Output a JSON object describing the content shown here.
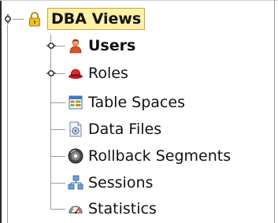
{
  "tree": {
    "root": {
      "label": "DBA Views",
      "icon": "lock-icon",
      "expanded": true,
      "selected": true
    },
    "children": [
      {
        "label": "Users",
        "icon": "user-icon",
        "bold": true,
        "expandable": true
      },
      {
        "label": "Roles",
        "icon": "red-hat-icon",
        "bold": false,
        "expandable": true
      },
      {
        "label": "Table Spaces",
        "icon": "table-icon",
        "bold": false,
        "expandable": false
      },
      {
        "label": "Data Files",
        "icon": "data-file-icon",
        "bold": false,
        "expandable": false
      },
      {
        "label": "Rollback Segments",
        "icon": "rollback-disc-icon",
        "bold": false,
        "expandable": false
      },
      {
        "label": "Sessions",
        "icon": "network-icon",
        "bold": false,
        "expandable": false
      },
      {
        "label": "Statistics",
        "icon": "gauge-icon",
        "bold": false,
        "expandable": false
      }
    ]
  },
  "colors": {
    "selection_fill": "#fff0a8",
    "selection_border": "#c9a838",
    "tree_lines": "#9c9c9c"
  }
}
